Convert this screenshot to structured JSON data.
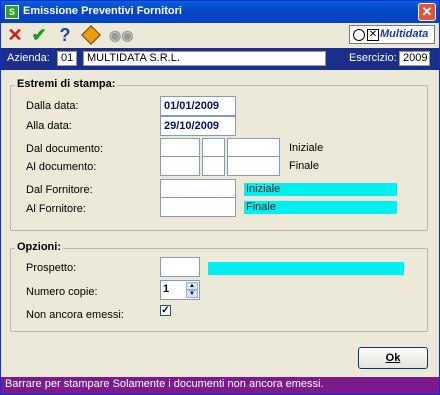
{
  "window": {
    "title": "Emissione Preventivi Fornitori",
    "app_icon_letter": "S"
  },
  "toolbar": {
    "icons": [
      "close-x-icon",
      "confirm-check-icon",
      "help-icon",
      "diamond-icon",
      "binoculars-icon"
    ]
  },
  "logo": {
    "text": "Multidata"
  },
  "info": {
    "azienda_label": "Azienda:",
    "azienda_code": "01",
    "azienda_name": "MULTIDATA S.R.L.",
    "esercizio_label": "Esercizio:",
    "esercizio_value": "2009"
  },
  "estremi": {
    "title": "Estremi di stampa:",
    "dalla_data_label": "Dalla data:",
    "dalla_data_value": "01/01/2009",
    "alla_data_label": "Alla data:",
    "alla_data_value": "29/10/2009",
    "dal_documento_label": "Dal documento:",
    "al_documento_label": "Al documento:",
    "iniziale_label": "Iniziale",
    "finale_label": "Finale",
    "dal_fornitore_label": "Dal Fornitore:",
    "al_fornitore_label": "Al Fornitore:",
    "fornitore_iniziale": "Iniziale",
    "fornitore_finale": "Finale"
  },
  "opzioni": {
    "title": "Opzioni:",
    "prospetto_label": "Prospetto:",
    "numero_copie_label": "Numero copie:",
    "numero_copie_value": "1",
    "non_ancora_label": "Non ancora emessi:",
    "non_ancora_checked": true
  },
  "buttons": {
    "ok_label": "Ok"
  },
  "status": {
    "text": "Barrare per stampare Solamente i documenti non ancora emessi."
  },
  "colors": {
    "title_bar": "#0544c4",
    "info_bar": "#1a2e8a",
    "status_bar": "#7b1a8a",
    "highlight": "#00f0f0"
  }
}
